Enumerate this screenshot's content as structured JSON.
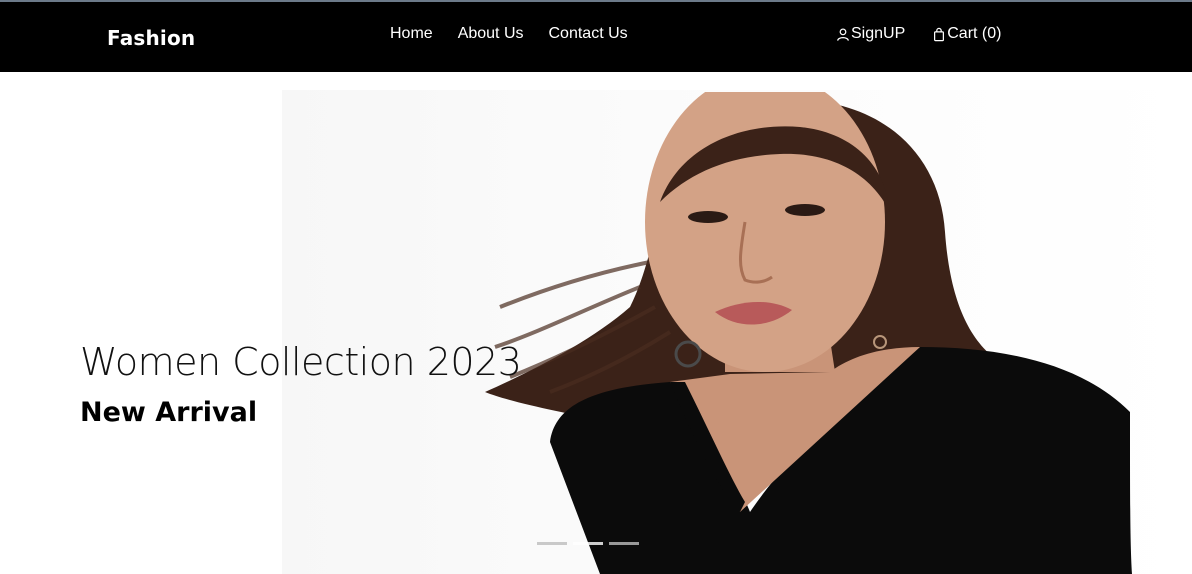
{
  "navbar": {
    "brand": "Fashion",
    "links": [
      {
        "label": "Home"
      },
      {
        "label": "About Us"
      },
      {
        "label": "Contact Us"
      }
    ],
    "signup_label": "SignUP",
    "cart_label": "Cart (0)",
    "icons": {
      "signup": "person-icon",
      "cart": "shopping-bag-icon"
    },
    "background_color": "#000000"
  },
  "hero": {
    "title": "Women Collection 2023",
    "subtitle": "New Arrival",
    "carousel_slides": 3,
    "active_slide": 1
  }
}
